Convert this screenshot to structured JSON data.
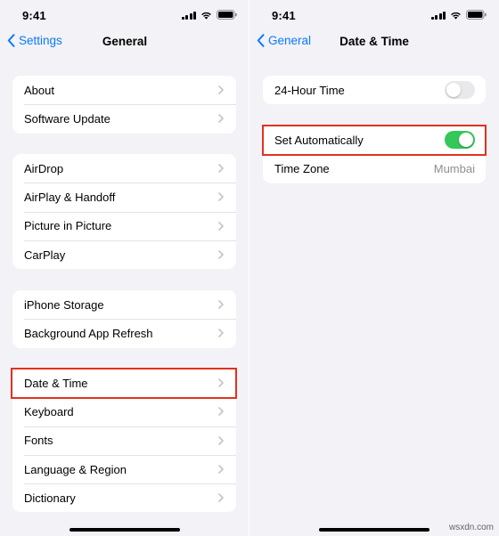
{
  "left": {
    "status_time": "9:41",
    "back_label": "Settings",
    "title": "General",
    "groups": [
      [
        "About",
        "Software Update"
      ],
      [
        "AirDrop",
        "AirPlay & Handoff",
        "Picture in Picture",
        "CarPlay"
      ],
      [
        "iPhone Storage",
        "Background App Refresh"
      ],
      [
        "Date & Time",
        "Keyboard",
        "Fonts",
        "Language & Region",
        "Dictionary"
      ]
    ]
  },
  "right": {
    "status_time": "9:41",
    "back_label": "General",
    "title": "Date & Time",
    "hour24": {
      "label": "24-Hour Time",
      "on": false
    },
    "set_auto": {
      "label": "Set Automatically",
      "on": true
    },
    "time_zone": {
      "label": "Time Zone",
      "value": "Mumbai"
    }
  },
  "colors": {
    "accent": "#0a7aff",
    "toggle_on": "#34c759",
    "highlight": "#e0321f"
  },
  "watermark": "wsxdn.com"
}
